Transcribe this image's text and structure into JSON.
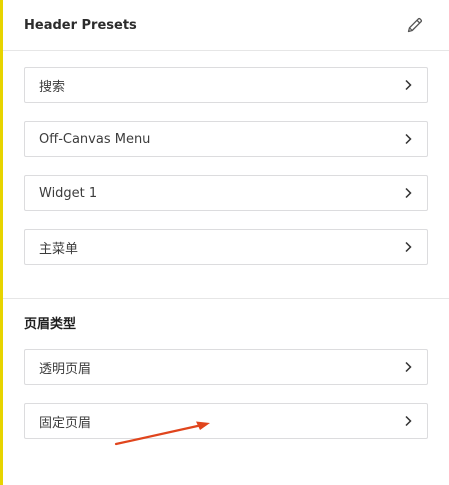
{
  "header_presets": {
    "title": "Header Presets",
    "edit_icon": "pencil-icon",
    "items": [
      {
        "label": "搜索"
      },
      {
        "label": "Off-Canvas Menu"
      },
      {
        "label": "Widget 1"
      },
      {
        "label": "主菜单"
      }
    ]
  },
  "header_types": {
    "title": "页眉类型",
    "items": [
      {
        "label": "透明页眉"
      },
      {
        "label": "固定页眉"
      }
    ]
  },
  "colors": {
    "accent_bar": "#e7d400",
    "annotation_arrow": "#e0451d"
  }
}
